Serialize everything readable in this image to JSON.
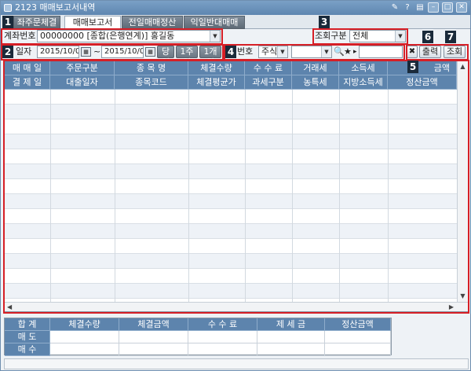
{
  "window": {
    "title": "2123 매매보고서내역",
    "controls": [
      "✎",
      "?",
      "▤",
      "–",
      "□",
      "✕"
    ]
  },
  "badges": [
    "1",
    "2",
    "3",
    "4",
    "5",
    "6",
    "7"
  ],
  "tabs": [
    {
      "label": "좌주문체결"
    },
    {
      "label": "매매보고서",
      "active": true
    },
    {
      "label": "전일매매정산"
    },
    {
      "label": "익일반대매매"
    }
  ],
  "account": {
    "label": "계좌번호",
    "value": "00000000 [종합(은행연계)] 홍길동"
  },
  "query_type": {
    "label": "조회구분",
    "value": "전체"
  },
  "date": {
    "label": "일자",
    "from": "2015/10/05",
    "tilde": "~",
    "to": "2015/10/05",
    "btn_today": "당일",
    "btn_week": "1주일",
    "btn_month": "1개월"
  },
  "item": {
    "label": "번호",
    "type_value": "주식",
    "code_value": ""
  },
  "buttons": {
    "print": "출력",
    "query": "조회"
  },
  "grid": {
    "header_row1": [
      "매 매 일",
      "주문구분",
      "종 목 명",
      "체결수량",
      "수 수 료",
      "거래세",
      "소득세",
      "금액"
    ],
    "header_row2": [
      "결 제 일",
      "대출일자",
      "종목코드",
      "체결평균가",
      "과세구분",
      "농특세",
      "지방소득세",
      "정산금액"
    ],
    "rows": 14
  },
  "summary": {
    "headers": [
      "합   계",
      "체결수량",
      "체결금액",
      "수 수 료",
      "제 세 금",
      "정산금액"
    ],
    "rows": [
      "매   도",
      "매   수"
    ]
  }
}
